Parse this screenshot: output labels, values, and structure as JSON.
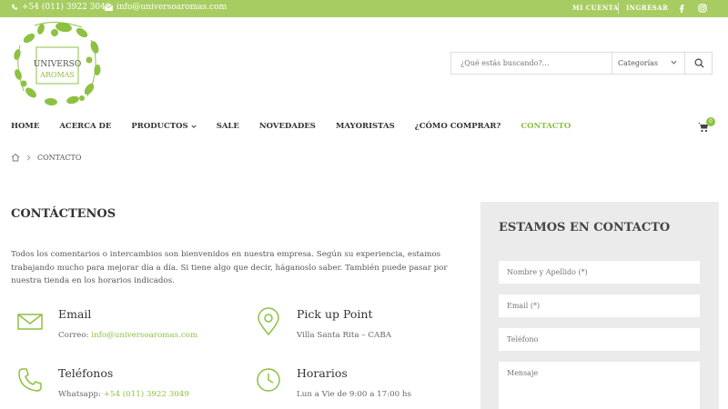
{
  "topbar": {
    "phone": "+54 (011) 3922 3049",
    "email": "info@universoaromas.com",
    "my_account": "MI CUENTA",
    "login": "INGRESAR",
    "social": [
      "facebook-icon",
      "instagram-icon"
    ]
  },
  "logo": {
    "line1": "UNIVERSO",
    "line2": "AROMAS"
  },
  "search": {
    "placeholder": "¿Qué estás buscando?...",
    "category": "Categorías"
  },
  "nav": {
    "items": [
      {
        "label": "HOME"
      },
      {
        "label": "ACERCA DE"
      },
      {
        "label": "PRODUCTOS",
        "dropdown": true
      },
      {
        "label": "SALE"
      },
      {
        "label": "NOVEDADES"
      },
      {
        "label": "MAYORISTAS"
      },
      {
        "label": "¿CÓMO COMPRAR?"
      },
      {
        "label": "CONTACTO",
        "active": true
      }
    ],
    "cart_count": "0"
  },
  "breadcrumb": {
    "current": "CONTACTO"
  },
  "main": {
    "heading": "CONTÁCTENOS",
    "intro": "Todos los comentarios o intercambios son bienvenidos en nuestra empresa. Según su experiencia, estamos trabajando mucho para mejorar día a día. Si tiene algo que decir, háganoslo saber. También puede pasar por nuestra tienda en los horarios indicados.",
    "email_block": {
      "title": "Email",
      "prefix": "Correo:",
      "value": "info@universoaromas.com"
    },
    "pickup_block": {
      "title": "Pick up Point",
      "value": "Villa Santa Rita – CABA"
    },
    "phones_block": {
      "title": "Teléfonos",
      "prefix": "Whatsapp:",
      "value": "+54 (011) 3922 3049"
    },
    "hours_block": {
      "title": "Horarios",
      "line1": "Lun a Vie de 9:00 a 17:00 hs"
    }
  },
  "contact_form": {
    "title": "ESTAMOS EN CONTACTO",
    "name_placeholder": "Nombre y Apellido (*)",
    "email_placeholder": "Email (*)",
    "phone_placeholder": "Teléfono",
    "message_placeholder": "Mensaje"
  },
  "colors": {
    "accent": "#a7cd62",
    "accent_text": "#8dc142",
    "panel": "#ebebeb"
  }
}
